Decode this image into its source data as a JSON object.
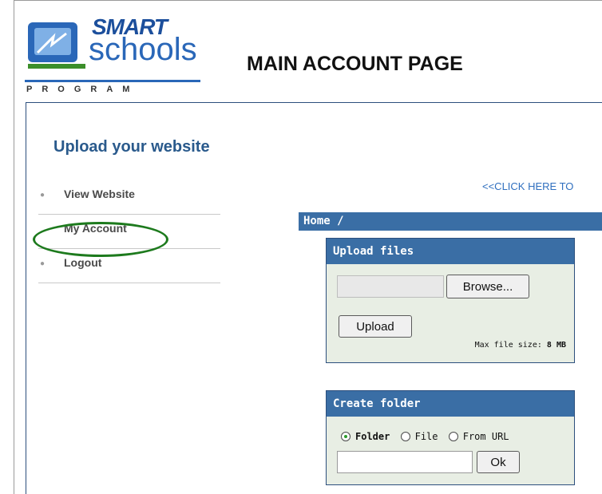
{
  "logo": {
    "line1": "SMART",
    "line2": "schools",
    "line3": "PROGRAM"
  },
  "page_title": "MAIN ACCOUNT PAGE",
  "sidebar": {
    "heading": "Upload your website",
    "items": [
      {
        "label": "View Website"
      },
      {
        "label": "My Account"
      },
      {
        "label": "Logout"
      }
    ]
  },
  "click_here": "<<CLICK HERE TO",
  "breadcrumb": "Home /",
  "upload_panel": {
    "title": "Upload files",
    "browse_label": "Browse...",
    "upload_label": "Upload",
    "max_size_text": "Max file size:",
    "max_size_value": "8 MB"
  },
  "folder_panel": {
    "title": "Create folder",
    "options": [
      "Folder",
      "File",
      "From URL"
    ],
    "selected_option": "Folder",
    "ok_label": "Ok"
  },
  "colors": {
    "accent": "#3a6ea5",
    "heading": "#2a5a8c",
    "panel_bg": "#e8eee4",
    "highlight": "#1d7a1d"
  }
}
